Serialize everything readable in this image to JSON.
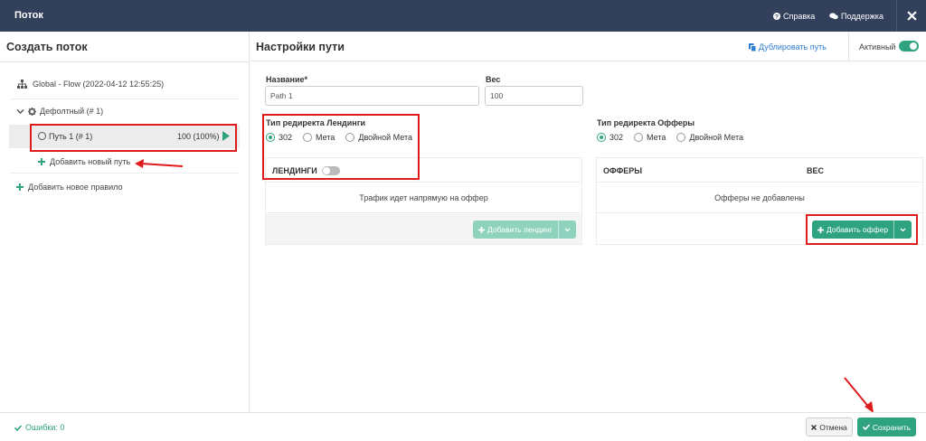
{
  "header": {
    "title": "Поток",
    "help_label": "Справка",
    "support_label": "Поддержка"
  },
  "sidebar": {
    "title": "Создать поток",
    "global_flow": "Global - Flow (2022-04-12 12:55:25)",
    "default_group": "Дефолтный (# 1)",
    "path_name": "Путь 1 (# 1)",
    "path_weight": "100 (100%)",
    "add_path": "Добавить новый путь",
    "add_rule": "Добавить новое правило"
  },
  "main": {
    "title": "Настройки пути",
    "duplicate_label": "Дублировать путь",
    "active_label": "Активный",
    "active": true,
    "name_label": "Название*",
    "name_value": "Path 1",
    "weight_label": "Вес",
    "weight_value": "100",
    "landing_redirect": {
      "label": "Тип редиректа Лендинги",
      "options": [
        "302",
        "Мета",
        "Двойной Мета"
      ],
      "selected": "302"
    },
    "offer_redirect": {
      "label": "Тип редиректа Офферы",
      "options": [
        "302",
        "Мета",
        "Двойной Мета"
      ],
      "selected": "302"
    },
    "landings": {
      "header": "ЛЕНДИНГИ",
      "toggle_on": false,
      "message": "Трафик идет напрямую на оффер",
      "add_button": "Добавить лендинг"
    },
    "offers": {
      "header_offers": "ОФФЕРЫ",
      "header_weight": "ВЕС",
      "message": "Офферы не добавлены",
      "add_button": "Добавить оффер"
    }
  },
  "footer": {
    "errors": "Ошибки: 0",
    "cancel": "Отмена",
    "save": "Сохранить"
  },
  "colors": {
    "topbar": "#32405b",
    "accent": "#2fa37f",
    "link": "#2d7fd3",
    "annotation": "#e01b1b"
  }
}
